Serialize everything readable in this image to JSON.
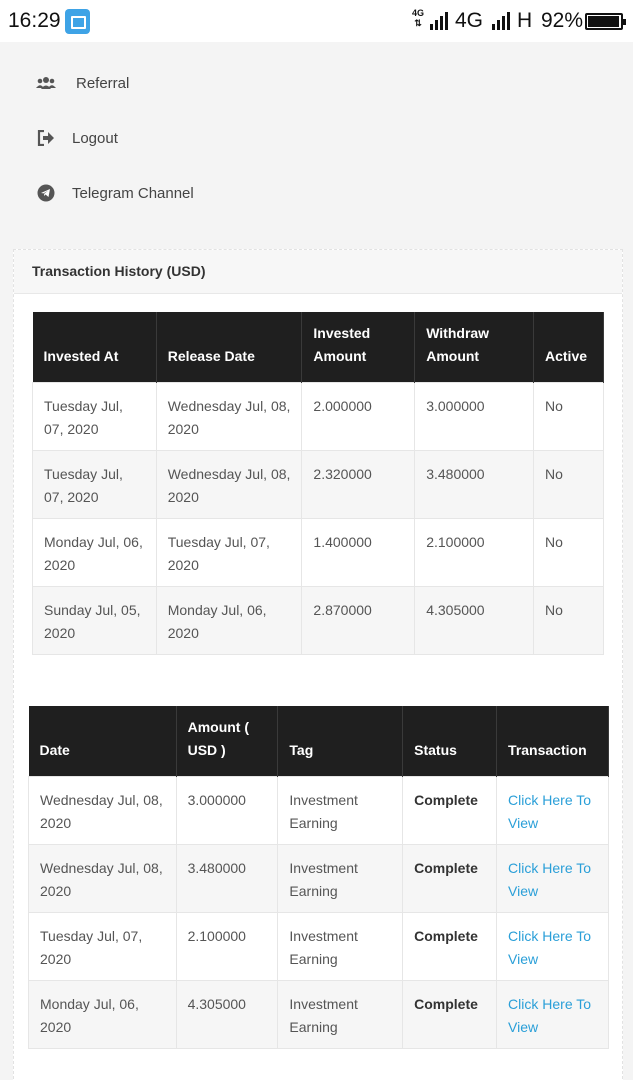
{
  "status_bar": {
    "time": "16:29",
    "network_small": "4G",
    "network": "4G",
    "network2": "H",
    "battery": "92%"
  },
  "menu": [
    {
      "label": "Referral",
      "icon": "users-icon"
    },
    {
      "label": "Logout",
      "icon": "logout-icon"
    },
    {
      "label": "Telegram Channel",
      "icon": "telegram-icon"
    }
  ],
  "panel_title": "Transaction History (USD)",
  "investments": {
    "headers": [
      "Invested At",
      "Release Date",
      "Invested Amount",
      "Withdraw Amount",
      "Active"
    ],
    "rows": [
      {
        "invested_at": "Tuesday Jul, 07, 2020",
        "release_date": "Wednesday Jul, 08, 2020",
        "invested": "2.000000",
        "withdraw": "3.000000",
        "active": "No"
      },
      {
        "invested_at": "Tuesday Jul, 07, 2020",
        "release_date": "Wednesday Jul, 08, 2020",
        "invested": "2.320000",
        "withdraw": "3.480000",
        "active": "No"
      },
      {
        "invested_at": "Monday Jul, 06, 2020",
        "release_date": "Tuesday Jul, 07, 2020",
        "invested": "1.400000",
        "withdraw": "2.100000",
        "active": "No"
      },
      {
        "invested_at": "Sunday Jul, 05, 2020",
        "release_date": "Monday Jul, 06, 2020",
        "invested": "2.870000",
        "withdraw": "4.305000",
        "active": "No"
      }
    ]
  },
  "transactions": {
    "headers": [
      "Date",
      "Amount ( USD )",
      "Tag",
      "Status",
      "Transaction"
    ],
    "rows": [
      {
        "date": "Wednesday Jul, 08, 2020",
        "amount": "3.000000",
        "tag": "Investment Earning",
        "status": "Complete",
        "link": "Click Here To View"
      },
      {
        "date": "Wednesday Jul, 08, 2020",
        "amount": "3.480000",
        "tag": "Investment Earning",
        "status": "Complete",
        "link": "Click Here To View"
      },
      {
        "date": "Tuesday Jul, 07, 2020",
        "amount": "2.100000",
        "tag": "Investment Earning",
        "status": "Complete",
        "link": "Click Here To View"
      },
      {
        "date": "Monday Jul, 06, 2020",
        "amount": "4.305000",
        "tag": "Investment Earning",
        "status": "Complete",
        "link": "Click Here To View"
      }
    ]
  },
  "colors": {
    "header_bg": "#1f1f1f",
    "link": "#2a9fd8",
    "accent_screenshot": "#3ea3e6"
  }
}
